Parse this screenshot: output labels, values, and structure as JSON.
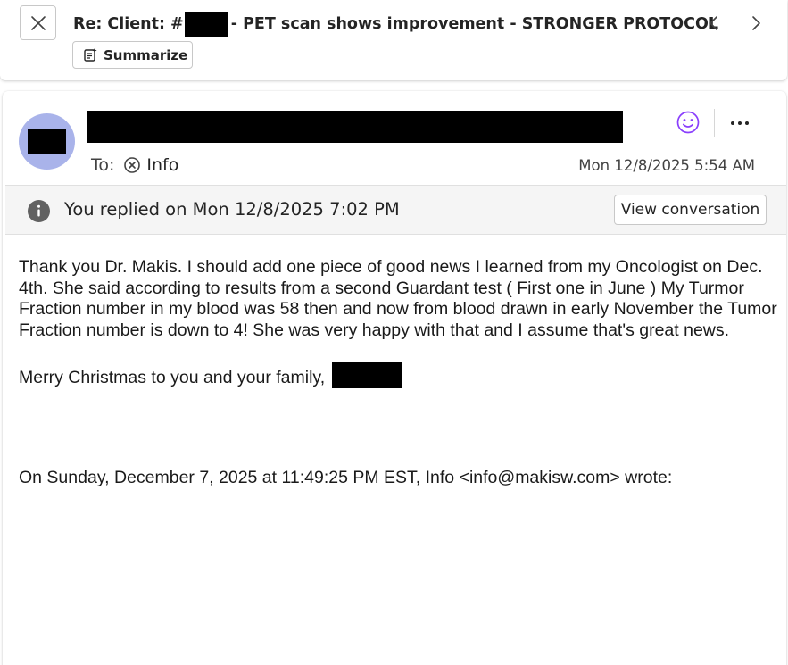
{
  "subject": {
    "prefix": "Re: Client: #",
    "suffix": "- PET scan shows improvement - STRONGER PROTOCOL",
    "summarize_label": "Summarize"
  },
  "message": {
    "to_label": "To:",
    "to_name": "Info",
    "date": "Mon 12/8/2025 5:54 AM",
    "avatar_color": "#a9b3ea",
    "emoji_color": "#8a3ffc"
  },
  "info_bar": {
    "text": "You replied on Mon 12/8/2025 7:02 PM",
    "view_conversation_label": "View conversation"
  },
  "body": {
    "paragraph1": "Thank you Dr. Makis.  I should add one piece of good news I learned from my Oncologist on Dec. 4th.  She said according to results from a second Guardant test ( First one in June )  My Turmor Fraction number in my blood was 58 then and now from blood drawn in early November the Tumor Fraction number is down to 4!  She was very happy with that and I assume that's great news.",
    "closing": "Merry Christmas to you and your family,",
    "quote_header": "On Sunday, December 7, 2025 at 11:49:25 PM EST, Info <info@makisw.com> wrote:"
  },
  "icons": {
    "close": "close-icon",
    "summarize": "summarize-icon",
    "prev": "chevron-left-icon",
    "next": "chevron-right-icon",
    "emoji": "smiley-icon",
    "more": "more-horizontal-icon",
    "recipient_status": "circle-x-icon",
    "info": "info-icon"
  }
}
